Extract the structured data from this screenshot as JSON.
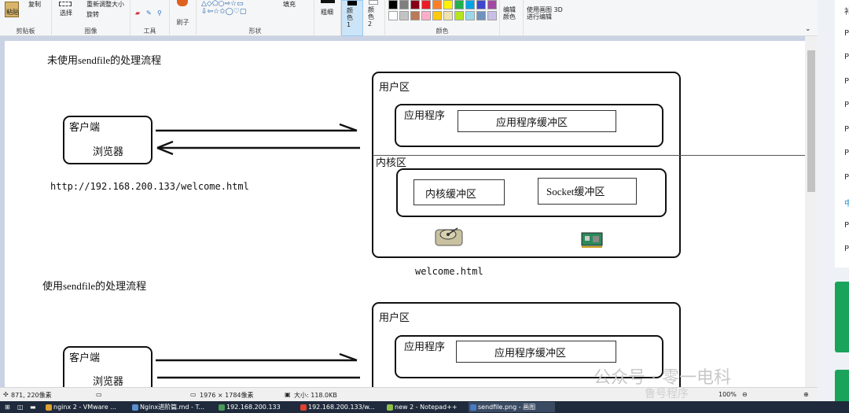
{
  "ribbon": {
    "clipboard": {
      "paste": "粘贴",
      "copy": "复制",
      "label": "剪贴板"
    },
    "image": {
      "select": "选择",
      "resize": "重新调整大小",
      "rotate": "旋转",
      "label": "图像"
    },
    "tools": {
      "label": "工具"
    },
    "brushes": {
      "label": "刷子"
    },
    "shapes": {
      "fill": "填充",
      "label": "形状"
    },
    "size": {
      "label": "粗细"
    },
    "color1": {
      "label": "颜色 1"
    },
    "color2": {
      "label": "颜色 2"
    },
    "colors": {
      "label": "颜色",
      "edit": "编辑颜色"
    },
    "paint3d": {
      "label": "使用画图 3D 进行编辑"
    },
    "palette": [
      "#000000",
      "#7f7f7f",
      "#880015",
      "#ed1c24",
      "#ff7f27",
      "#fff200",
      "#22b14c",
      "#00a2e8",
      "#3f48cc",
      "#a349a4",
      "#ffffff",
      "#c3c3c3",
      "#b97a57",
      "#ffaec9",
      "#ffc90e",
      "#efe4b0",
      "#b5e61d",
      "#99d9ea",
      "#7092be",
      "#c8bfe7"
    ]
  },
  "canvas": {
    "section1_title": "未使用sendfile的处理流程",
    "section2_title": "使用sendfile的处理流程",
    "client_label": "客户端",
    "browser_label": "浏览器",
    "url": "http://192.168.200.133/welcome.html",
    "user_space": "用户区",
    "app": "应用程序",
    "app_buffer": "应用程序缓冲区",
    "kernel_space": "内核区",
    "kernel_buffer": "内核缓冲区",
    "socket_buffer": "Socket缓冲区",
    "file": "welcome.html"
  },
  "status": {
    "cursor": "871, 220像素",
    "dimensions": "1976 × 1784像素",
    "size": "大小: 118.0KB",
    "zoom": "100%"
  },
  "taskbar": [
    {
      "label": "nginx 2 - VMware ...",
      "color": "#e0a030"
    },
    {
      "label": "Nginx进阶篇.md - T...",
      "color": "#5a8fd0"
    },
    {
      "label": "192.168.200.133",
      "color": "#4a9a5a"
    },
    {
      "label": "192.168.200.133/w...",
      "color": "#e04030"
    },
    {
      "label": "new 2 - Notepad++",
      "color": "#8cc04a"
    },
    {
      "label": "sendfile.png - 画图",
      "color": "#4a7ac0"
    }
  ],
  "watermark": {
    "line1": "公众号 · 零一电科",
    "line2": "鲁号程序"
  },
  "rpanel": {
    "letters": [
      "补",
      "P",
      "P",
      "P",
      "P",
      "P",
      "P",
      "P",
      "中",
      "P",
      "P"
    ]
  }
}
